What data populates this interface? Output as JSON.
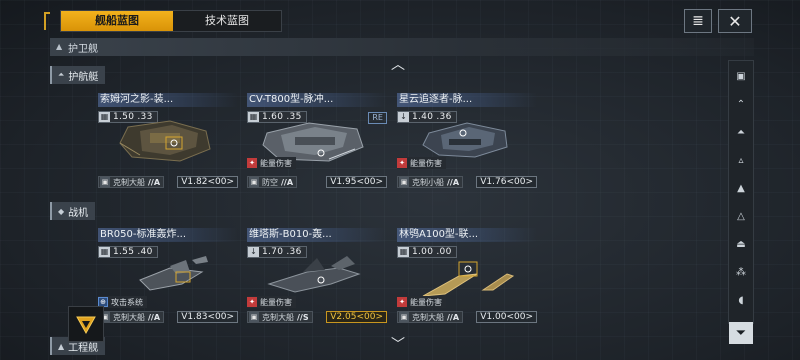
{
  "tabs": {
    "active": "舰船蓝图",
    "inactive": "技术蓝图"
  },
  "top_buttons": {
    "list_icon": "list-icon",
    "close_icon": "close-icon",
    "close_glyph": "✕",
    "list_glyph": "≣"
  },
  "category": {
    "label": "护卫舰"
  },
  "subcategories": {
    "frigate": "护航艇",
    "fighter": "战机",
    "engineering": "工程舰"
  },
  "cards": [
    {
      "name": "索姆河之影-装...",
      "stat": "1.50  .33",
      "stat_icon": "▦",
      "tag_text": "",
      "tag_color": "",
      "weapon": "克制大船",
      "div": "//A",
      "version": "V1.82<00>",
      "gold": false,
      "re": ""
    },
    {
      "name": "CV-T800型-脉冲...",
      "stat": "1.60  .35",
      "stat_icon": "▦",
      "tag_text": "能量伤害",
      "tag_color": "red",
      "weapon": "防空",
      "div": "//A",
      "version": "V1.95<00>",
      "gold": false,
      "re": "RE"
    },
    {
      "name": "星云追逐者-脉...",
      "stat": "1.40  .36",
      "stat_icon": "↓",
      "tag_text": "能量伤害",
      "tag_color": "red",
      "weapon": "克制小船",
      "div": "//A",
      "version": "V1.76<00>",
      "gold": false,
      "re": ""
    },
    {
      "name": "BR050-标准轰炸...",
      "stat": "1.55  .40",
      "stat_icon": "▦",
      "tag_text": "攻击系统",
      "tag_color": "blue",
      "weapon": "克制大船",
      "div": "//A",
      "version": "V1.83<00>",
      "gold": false,
      "re": ""
    },
    {
      "name": "维塔斯-B010-轰...",
      "stat": "1.70  .36",
      "stat_icon": "↓",
      "tag_text": "能量伤害",
      "tag_color": "red",
      "weapon": "克制大船",
      "div": "//S",
      "version": "V2.05<00>",
      "gold": true,
      "re": ""
    },
    {
      "name": "林鸮A100型-联...",
      "stat": "1.00  .00",
      "stat_icon": "▦",
      "tag_text": "能量伤害",
      "tag_color": "red",
      "weapon": "克制大船",
      "div": "//A",
      "version": "V1.00<00>",
      "gold": false,
      "re": ""
    }
  ],
  "right_icons": [
    "lock-icon",
    "chevrons-up-icon",
    "frigate-class-icon",
    "destroyer-class-icon",
    "cruiser-class-icon",
    "battlecruiser-class-icon",
    "carrier-class-icon",
    "auxiliary-class-icon",
    "dome-class-icon"
  ],
  "filter_icon": "filter-icon",
  "colors": {
    "accent": "#f3b21d",
    "red_tag": "#c23b3b",
    "gold_version": "#f0c33d",
    "name_band": "#5c78af"
  }
}
